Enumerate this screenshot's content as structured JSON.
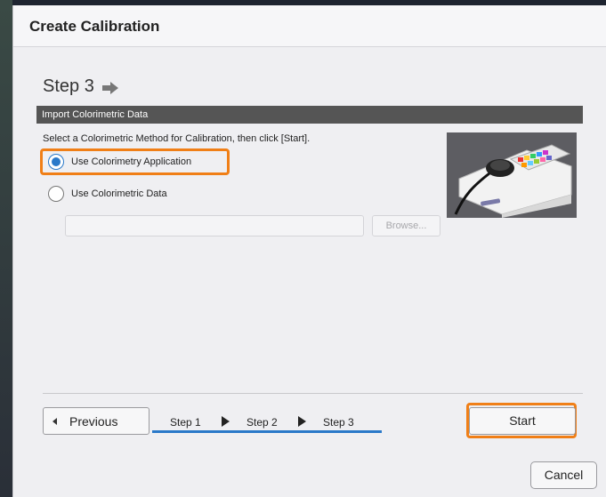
{
  "dialog": {
    "title": "Create Calibration",
    "step_heading": "Step 3",
    "section_title": "Import Colorimetric Data",
    "instruction": "Select a Colorimetric Method for Calibration, then click [Start].",
    "options": [
      {
        "label": "Use Colorimetry Application",
        "selected": true
      },
      {
        "label": "Use Colorimetric Data",
        "selected": false
      }
    ],
    "file_path_value": "",
    "browse_label": "Browse...",
    "image_icon": "colorimeter-device-image"
  },
  "footer": {
    "previous_label": "Previous",
    "steps": [
      "Step 1",
      "Step 2",
      "Step 3"
    ],
    "current_step": 3,
    "start_label": "Start",
    "cancel_label": "Cancel"
  },
  "colors": {
    "highlight": "#f07f17",
    "accent": "#2a79c9",
    "section_bar": "#555555"
  }
}
